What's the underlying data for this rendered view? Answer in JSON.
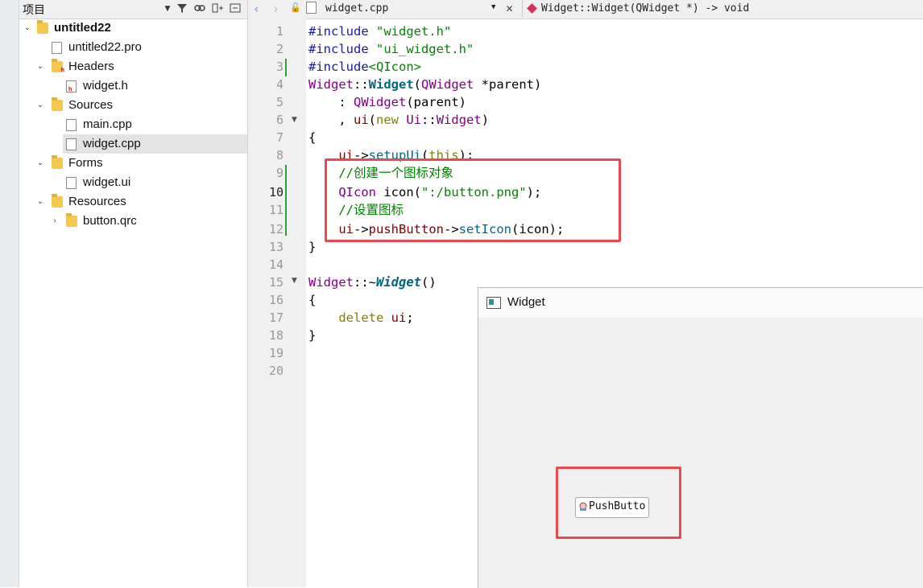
{
  "project_pane": {
    "title": "项目",
    "tree": [
      {
        "label": "untitled22",
        "type": "project",
        "expanded": true
      },
      {
        "label": "untitled22.pro",
        "type": "pro-file"
      },
      {
        "label": "Headers",
        "type": "folder",
        "expanded": true
      },
      {
        "label": "widget.h",
        "type": "header-file"
      },
      {
        "label": "Sources",
        "type": "folder",
        "expanded": true
      },
      {
        "label": "main.cpp",
        "type": "source-file"
      },
      {
        "label": "widget.cpp",
        "type": "source-file",
        "selected": true
      },
      {
        "label": "Forms",
        "type": "folder",
        "expanded": true
      },
      {
        "label": "widget.ui",
        "type": "form-file"
      },
      {
        "label": "Resources",
        "type": "folder",
        "expanded": true
      },
      {
        "label": "button.qrc",
        "type": "qrc-file",
        "expanded": false
      }
    ]
  },
  "editor": {
    "file_tab": "widget.cpp",
    "symbol": "Widget::Widget(QWidget *) -> void",
    "current_line": "10",
    "line_numbers": [
      "1",
      "2",
      "3",
      "4",
      "5",
      "6",
      "7",
      "8",
      "9",
      "10",
      "11",
      "12",
      "13",
      "14",
      "15",
      "16",
      "17",
      "18",
      "19",
      "20"
    ],
    "code": {
      "l1a": "#include",
      "l1b": " \"widget.h\"",
      "l2a": "#include",
      "l2b": " \"ui_widget.h\"",
      "l3a": "#include",
      "l3b": "<QIcon>",
      "l4a": "Widget",
      "l4b": "::",
      "l4c": "Widget",
      "l4d": "(",
      "l4e": "QWidget",
      "l4f": " *parent)",
      "l5a": "    : ",
      "l5b": "QWidget",
      "l5c": "(parent)",
      "l6a": "    , ",
      "l6b": "ui",
      "l6c": "(",
      "l6d": "new",
      "l6e": " ",
      "l6f": "Ui",
      "l6g": "::",
      "l6h": "Widget",
      "l6i": ")",
      "l7": "{",
      "l8a": "    ",
      "l8b": "ui",
      "l8c": "->",
      "l8d": "setupUi",
      "l8e": "(",
      "l8f": "this",
      "l8g": ");",
      "l9": "    //创建一个图标对象",
      "l10a": "    ",
      "l10b": "QIcon",
      "l10c": " icon(",
      "l10d": "\":/button.png\"",
      "l10e": ");",
      "l11": "    //设置图标",
      "l12a": "    ",
      "l12b": "ui",
      "l12c": "->",
      "l12d": "pushButton",
      "l12e": "->",
      "l12f": "setIcon",
      "l12g": "(icon);",
      "l13": "}",
      "l15a": "Widget",
      "l15b": "::~",
      "l15c": "Widget",
      "l15d": "()",
      "l16": "{",
      "l17a": "    ",
      "l17b": "delete",
      "l17c": " ",
      "l17d": "ui",
      "l17e": ";",
      "l18": "}"
    }
  },
  "widget_window": {
    "title": "Widget",
    "button_label": "PushButto"
  },
  "colors": {
    "highlight_box": "#e84a4f",
    "keyword": "#1b1b9e",
    "string": "#0a7d0a",
    "type": "#800080",
    "function": "#00677c",
    "comment": "#008000"
  }
}
